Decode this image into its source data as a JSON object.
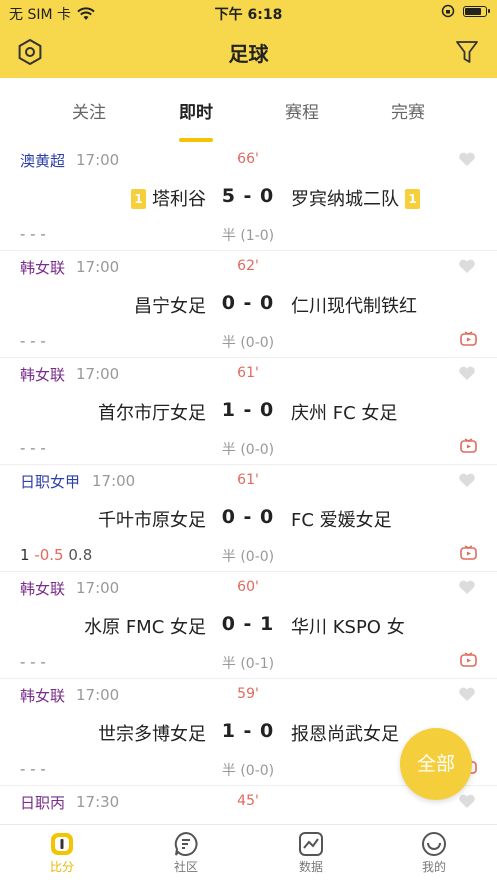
{
  "status_bar": {
    "carrier": "无 SIM 卡",
    "time": "下午 6:18",
    "battery_level": 0.85
  },
  "header": {
    "title": "足球"
  },
  "tabs": [
    {
      "label": "关注",
      "active": false
    },
    {
      "label": "即时",
      "active": true
    },
    {
      "label": "赛程",
      "active": false
    },
    {
      "label": "完赛",
      "active": false
    }
  ],
  "matches": [
    {
      "league": "澳黄超",
      "league_color": "#2d3fa8",
      "kickoff": "17:00",
      "minute": "66'",
      "home": "塔利谷",
      "home_cards": "1",
      "score": "5 - 0",
      "away": "罗宾纳城二队",
      "away_cards": "1",
      "odds": [
        "- - -"
      ],
      "half": "半 (1-0)",
      "live": false
    },
    {
      "league": "韩女联",
      "league_color": "#7a2d8c",
      "kickoff": "17:00",
      "minute": "62'",
      "home": "昌宁女足",
      "score": "0 - 0",
      "away": "仁川现代制铁红",
      "odds": [
        "- - -"
      ],
      "half": "半 (0-0)",
      "live": true
    },
    {
      "league": "韩女联",
      "league_color": "#7a2d8c",
      "kickoff": "17:00",
      "minute": "61'",
      "home": "首尔市厅女足",
      "score": "1 - 0",
      "away": "庆州 FC 女足",
      "odds": [
        "- - -"
      ],
      "half": "半 (0-0)",
      "live": true
    },
    {
      "league": "日职女甲",
      "league_color": "#2d3fa8",
      "kickoff": "17:00",
      "minute": "61'",
      "home": "千叶市原女足",
      "score": "0 - 0",
      "away": "FC 爱媛女足",
      "odds": [
        "1",
        "-0.5",
        "0.8"
      ],
      "half": "半 (0-0)",
      "live": true
    },
    {
      "league": "韩女联",
      "league_color": "#7a2d8c",
      "kickoff": "17:00",
      "minute": "60'",
      "home": "水原 FMC 女足",
      "score": "0 - 1",
      "away": "华川 KSPO 女",
      "odds": [
        "- - -"
      ],
      "half": "半 (0-1)",
      "live": true
    },
    {
      "league": "韩女联",
      "league_color": "#7a2d8c",
      "kickoff": "17:00",
      "minute": "59'",
      "home": "世宗多博女足",
      "score": "1 - 0",
      "away": "报恩尚武女足",
      "odds": [
        "- - -"
      ],
      "half": "半 (0-0)",
      "live": true
    },
    {
      "league": "日职丙",
      "league_color": "#7a2d8c",
      "kickoff": "17:30",
      "minute": "45'",
      "home": "",
      "score": "",
      "away": "",
      "odds": [],
      "half": "",
      "live": false
    }
  ],
  "fab": {
    "label": "全部"
  },
  "bottom_nav": [
    {
      "label": "比分",
      "icon": "score-icon",
      "active": true
    },
    {
      "label": "社区",
      "icon": "community-icon",
      "active": false
    },
    {
      "label": "数据",
      "icon": "data-icon",
      "active": false
    },
    {
      "label": "我的",
      "icon": "profile-icon",
      "active": false
    }
  ],
  "colors": {
    "brand_yellow": "#f7d74c",
    "accent_red": "#e06a5e",
    "card_yellow": "#f7cf3a"
  }
}
